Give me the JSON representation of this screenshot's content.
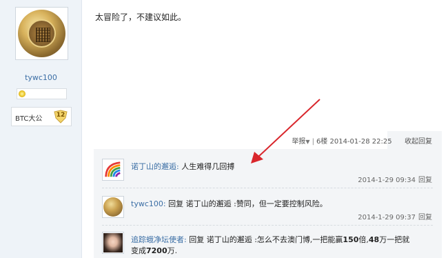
{
  "user": {
    "username": "tywc100",
    "rank_name": "BTC大公",
    "rank_level": "12"
  },
  "post": {
    "text": "太冒险了，不建议如此。"
  },
  "post_meta": {
    "report_label": "举报",
    "floor": "6楼",
    "timestamp": "2014-01-28 22:25",
    "collapse_label": "收起回复"
  },
  "comments": [
    {
      "name": "诺丁山的邂逅:",
      "text": "人生难得几回搏",
      "time": "2014-1-29 09:34",
      "reply_label": "回复"
    },
    {
      "name": "tywc100:",
      "text": "回复 诺丁山的邂逅 :赞同，但一定要控制风险。",
      "time": "2014-1-29 09:37",
      "reply_label": "回复"
    },
    {
      "name": "追踪蛾净坛使者:",
      "text_pre": "回复 诺丁山的邂逅 :怎么不去澳门博,一把能赢",
      "num1": "150",
      "text_mid1": "倍,",
      "num2": "48",
      "text_mid2": "万一把就",
      "line2_pre": "变成",
      "num3": "7200",
      "line2_post": "万."
    }
  ],
  "colors": {
    "link_blue": "#3b6ea5",
    "arrow_red": "#d9262c",
    "panel_bg": "#f3f5f7",
    "sidebar_bg": "#eef3f8"
  }
}
